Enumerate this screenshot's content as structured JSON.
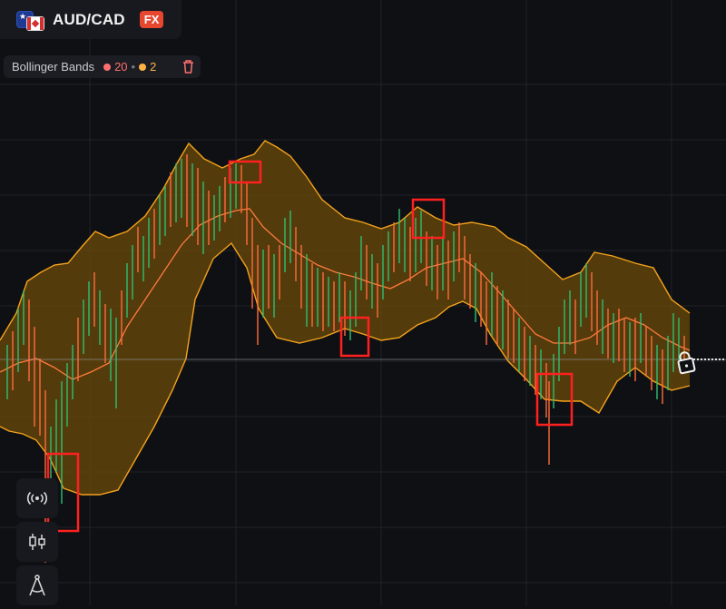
{
  "header": {
    "pair": "AUD/CAD",
    "market_badge": "FX"
  },
  "indicator": {
    "name": "Bollinger Bands",
    "period": "20",
    "stddev": "2",
    "period_color": "#ff6f6f",
    "stddev_color": "#ffb347"
  },
  "colors": {
    "background": "#0f1014",
    "band_fill": "#6b4a08",
    "band_line": "#f4a21c",
    "mid_line": "#ff7a3d",
    "candle_up": "#2fbf71",
    "candle_down": "#ff6b3d",
    "highlight": "#ff2020"
  },
  "toolbar": {
    "icons": [
      "signal-icon",
      "candles-icon",
      "compass-icon"
    ]
  },
  "lock": {
    "icon": "lock-icon"
  }
}
